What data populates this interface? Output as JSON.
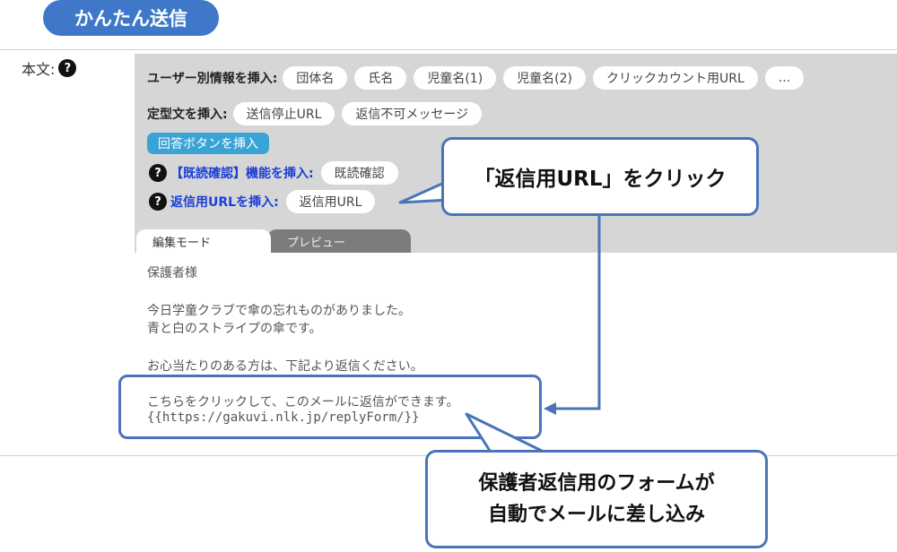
{
  "title": "かんたん送信",
  "body_label": "本文:",
  "help_glyph": "?",
  "user_info": {
    "label": "ユーザー別情報を挿入:",
    "chips": [
      "団体名",
      "氏名",
      "児童名(1)",
      "児童名(2)",
      "クリックカウント用URL",
      "..."
    ]
  },
  "template_text": {
    "label": "定型文を挿入:",
    "chips": [
      "送信停止URL",
      "返信不可メッセージ"
    ]
  },
  "reply_button": "回答ボタンを挿入",
  "read_confirm": {
    "label": "【既読確認】機能を挿入:",
    "chip": "既読確認"
  },
  "reply_url": {
    "label": "返信用URLを挿入:",
    "chip": "返信用URL"
  },
  "tabs": {
    "edit": "編集モード",
    "preview": "プレビュー"
  },
  "editor_lines": [
    "保護者様",
    "今日学童クラブで傘の忘れものがありました。",
    "青と白のストライプの傘です。",
    "お心当たりのある方は、下記より返信ください。",
    "こちらをクリックして、このメールに返信ができます。",
    "{{https://gakuvi.nlk.jp/replyForm/}}"
  ],
  "callouts": {
    "top": "「返信用URL」をクリック",
    "bottom_line1": "保護者返信用のフォームが",
    "bottom_line2": "自動でメールに差し込み"
  },
  "colors": {
    "accent": "#3f78c8",
    "callout_border": "#4a74b8",
    "reply_button": "#3aa3d6",
    "blue_label": "#1a3fd8"
  }
}
